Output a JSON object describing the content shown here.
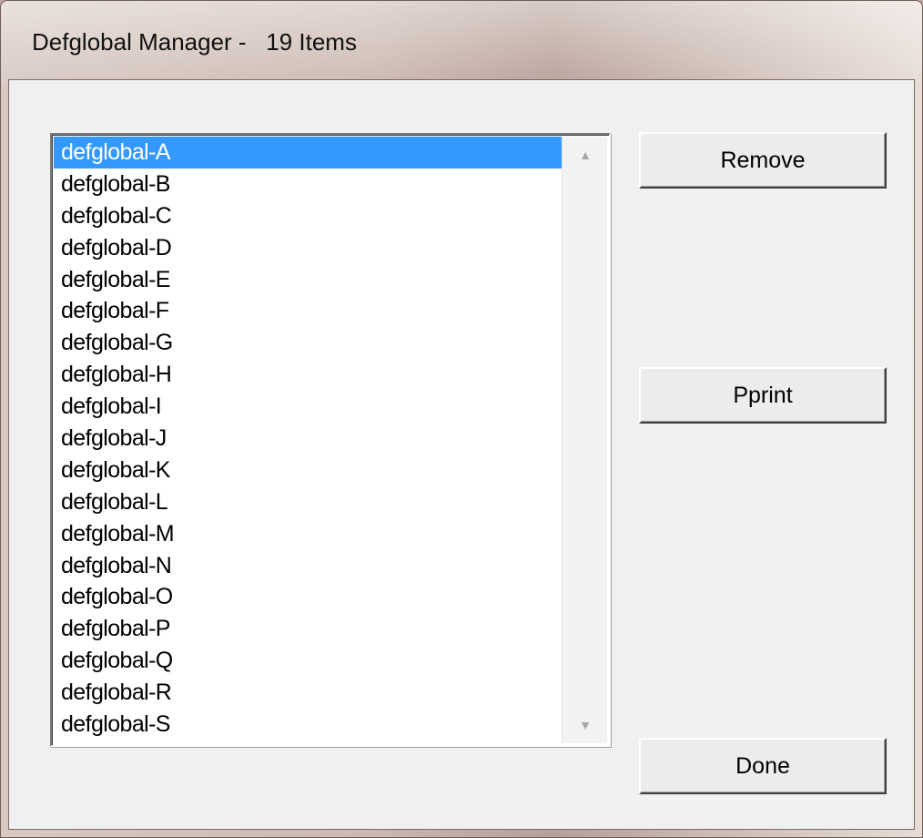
{
  "window": {
    "title": "Defglobal Manager -   19 Items"
  },
  "list": {
    "items": [
      "defglobal-A",
      "defglobal-B",
      "defglobal-C",
      "defglobal-D",
      "defglobal-E",
      "defglobal-F",
      "defglobal-G",
      "defglobal-H",
      "defglobal-I",
      "defglobal-J",
      "defglobal-K",
      "defglobal-L",
      "defglobal-M",
      "defglobal-N",
      "defglobal-O",
      "defglobal-P",
      "defglobal-Q",
      "defglobal-R",
      "defglobal-S"
    ],
    "selected_index": 0
  },
  "buttons": {
    "remove": "Remove",
    "pprint": "Pprint",
    "done": "Done"
  },
  "scrollbar": {
    "up_icon": "scroll-up-arrow-icon",
    "down_icon": "scroll-down-arrow-icon"
  },
  "colors": {
    "selection": "#3399ff",
    "dialog_bg": "#f0f0f0"
  }
}
